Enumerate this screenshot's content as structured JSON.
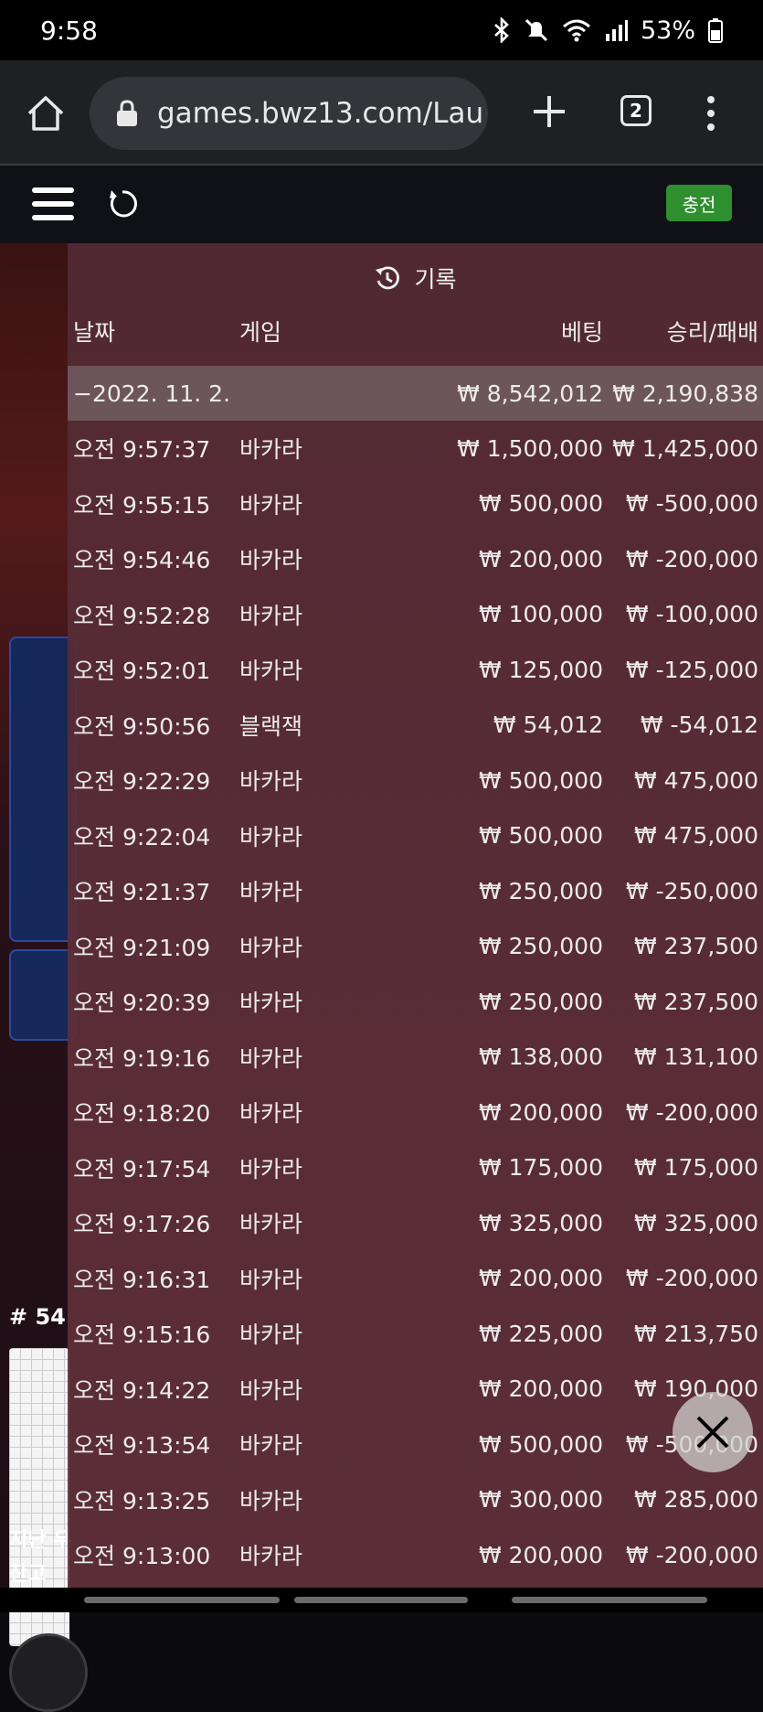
{
  "status": {
    "time": "9:58",
    "battery": "53%"
  },
  "browser": {
    "url": "games.bwz13.com/Lau",
    "tab_count": "2"
  },
  "header": {
    "charge_label": "충전"
  },
  "background": {
    "round": "# 54",
    "last_label": "지난 우",
    "balance_label": "잔고"
  },
  "history": {
    "title": "기록",
    "columns": {
      "date": "날짜",
      "game": "게임",
      "bet": "베팅",
      "result": "승리/패배"
    },
    "day": {
      "date": "−2022. 11. 2.",
      "bet": "₩ 8,542,012",
      "result": "₩ 2,190,838"
    },
    "rows": [
      {
        "time": "오전 9:57:37",
        "game": "바카라",
        "bet": "₩ 1,500,000",
        "result": "₩ 1,425,000"
      },
      {
        "time": "오전 9:55:15",
        "game": "바카라",
        "bet": "₩ 500,000",
        "result": "₩ -500,000"
      },
      {
        "time": "오전 9:54:46",
        "game": "바카라",
        "bet": "₩ 200,000",
        "result": "₩ -200,000"
      },
      {
        "time": "오전 9:52:28",
        "game": "바카라",
        "bet": "₩ 100,000",
        "result": "₩ -100,000"
      },
      {
        "time": "오전 9:52:01",
        "game": "바카라",
        "bet": "₩ 125,000",
        "result": "₩ -125,000"
      },
      {
        "time": "오전 9:50:56",
        "game": "블랙잭",
        "bet": "₩ 54,012",
        "result": "₩ -54,012"
      },
      {
        "time": "오전 9:22:29",
        "game": "바카라",
        "bet": "₩ 500,000",
        "result": "₩ 475,000"
      },
      {
        "time": "오전 9:22:04",
        "game": "바카라",
        "bet": "₩ 500,000",
        "result": "₩ 475,000"
      },
      {
        "time": "오전 9:21:37",
        "game": "바카라",
        "bet": "₩ 250,000",
        "result": "₩ -250,000"
      },
      {
        "time": "오전 9:21:09",
        "game": "바카라",
        "bet": "₩ 250,000",
        "result": "₩ 237,500"
      },
      {
        "time": "오전 9:20:39",
        "game": "바카라",
        "bet": "₩ 250,000",
        "result": "₩ 237,500"
      },
      {
        "time": "오전 9:19:16",
        "game": "바카라",
        "bet": "₩ 138,000",
        "result": "₩ 131,100"
      },
      {
        "time": "오전 9:18:20",
        "game": "바카라",
        "bet": "₩ 200,000",
        "result": "₩ -200,000"
      },
      {
        "time": "오전 9:17:54",
        "game": "바카라",
        "bet": "₩ 175,000",
        "result": "₩ 175,000"
      },
      {
        "time": "오전 9:17:26",
        "game": "바카라",
        "bet": "₩ 325,000",
        "result": "₩ 325,000"
      },
      {
        "time": "오전 9:16:31",
        "game": "바카라",
        "bet": "₩ 200,000",
        "result": "₩ -200,000"
      },
      {
        "time": "오전 9:15:16",
        "game": "바카라",
        "bet": "₩ 225,000",
        "result": "₩ 213,750"
      },
      {
        "time": "오전 9:14:22",
        "game": "바카라",
        "bet": "₩ 200,000",
        "result": "₩ 190,000"
      },
      {
        "time": "오전 9:13:54",
        "game": "바카라",
        "bet": "₩ 500,000",
        "result": "₩ -500,000"
      },
      {
        "time": "오전 9:13:25",
        "game": "바카라",
        "bet": "₩ 300,000",
        "result": "₩ 285,000"
      },
      {
        "time": "오전 9:13:00",
        "game": "바카라",
        "bet": "₩ 200,000",
        "result": "₩ -200,000"
      }
    ]
  }
}
